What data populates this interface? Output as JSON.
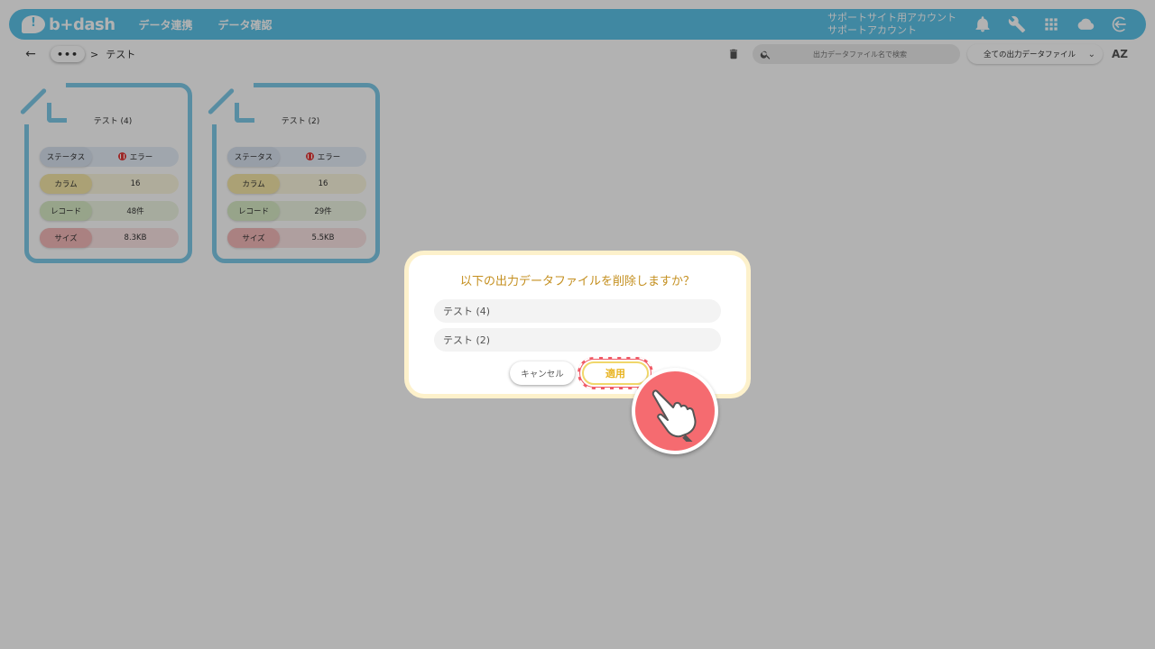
{
  "header": {
    "logo_text": "b+dash",
    "nav": [
      "データ連携",
      "データ確認"
    ],
    "account_line1": "サポートサイト用アカウント",
    "account_line2": "サポートアカウント",
    "icons": [
      "bell-icon",
      "wrench-icon",
      "apps-grid-icon",
      "cloud-icon",
      "logout-icon"
    ]
  },
  "toolbar": {
    "more_label": "•••",
    "breadcrumb_sep": ">",
    "breadcrumb_current": "テスト",
    "search_placeholder": "出力データファイル名で検索",
    "filter_value": "全ての出力データファイル",
    "sort_label": "AZ"
  },
  "cards": [
    {
      "title": "テスト (4)",
      "status_label": "ステータス",
      "status_value": "エラー",
      "column_label": "カラム",
      "column_value": "16",
      "record_label": "レコード",
      "record_value": "48件",
      "size_label": "サイズ",
      "size_value": "8.3KB"
    },
    {
      "title": "テスト (2)",
      "status_label": "ステータス",
      "status_value": "エラー",
      "column_label": "カラム",
      "column_value": "16",
      "record_label": "レコード",
      "record_value": "29件",
      "size_label": "サイズ",
      "size_value": "5.5KB"
    }
  ],
  "dialog": {
    "title": "以下の出力データファイルを削除しますか？",
    "items": [
      "テスト (4)",
      "テスト (2)"
    ],
    "cancel_label": "キャンセル",
    "apply_label": "適用"
  },
  "colors": {
    "header": "#5cc3e9",
    "card_border": "#7fcbe8",
    "dialog_title": "#c48f1f",
    "apply_text": "#e9b422",
    "highlight": "#f05a66"
  }
}
